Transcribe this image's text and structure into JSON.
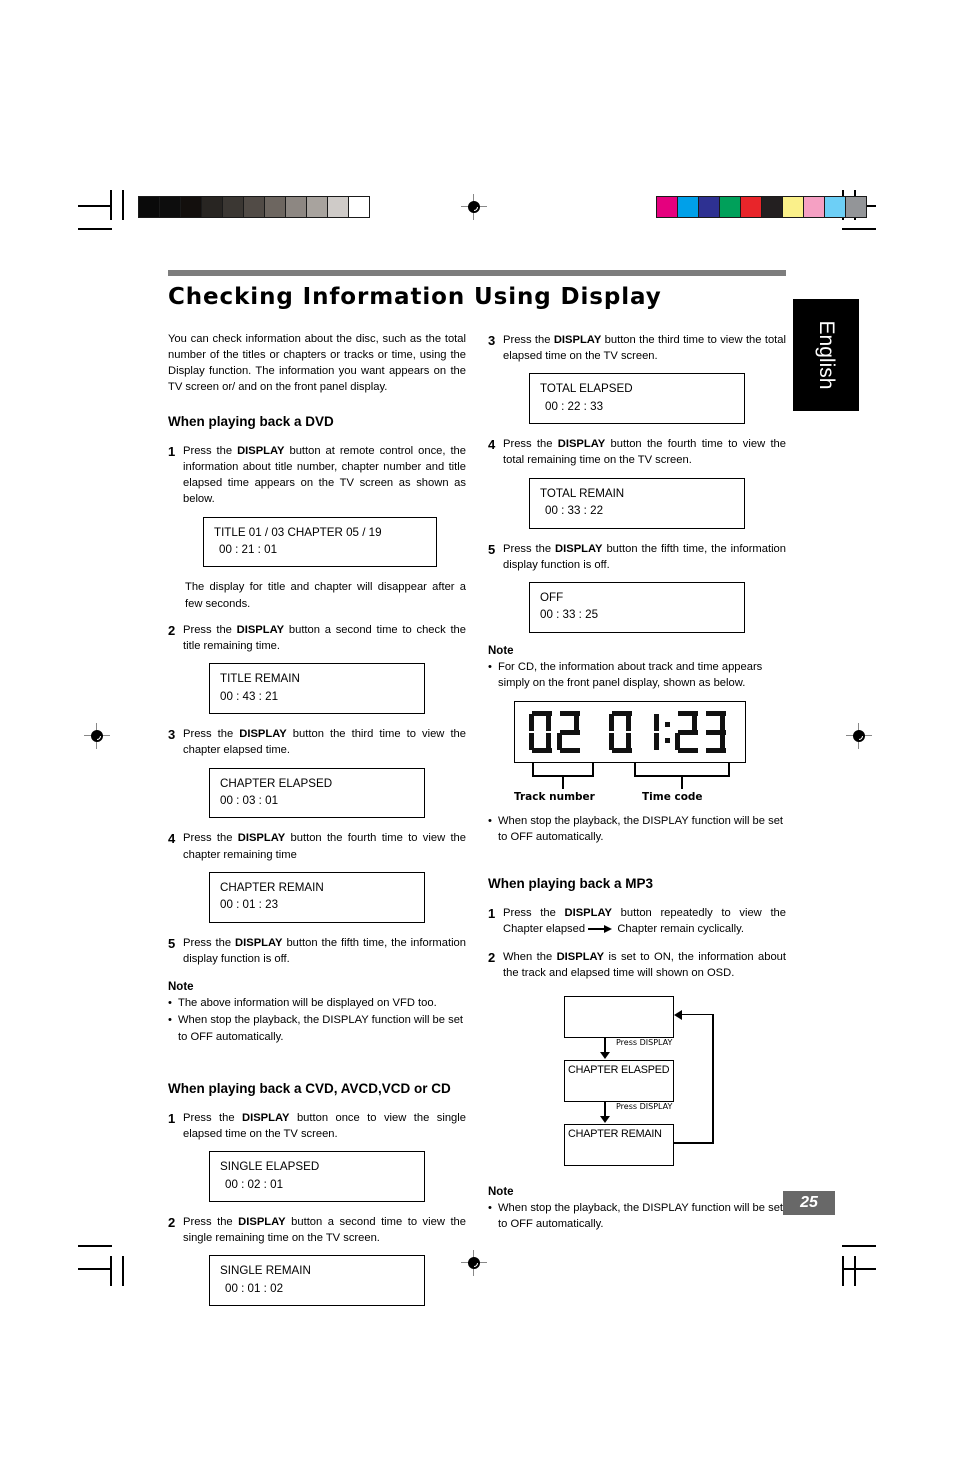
{
  "page": {
    "title": "Checking Information Using Display",
    "language_tab": "English",
    "page_number": "25"
  },
  "intro": "You can check information about the disc, such as the total number of the titles or chapters or tracks or time, using the Display function. The information you want appears on the TV screen or/ and on the front panel display.",
  "sections": {
    "dvd": {
      "heading": "When playing back a DVD",
      "steps": [
        {
          "num": "1",
          "pre": "Press the ",
          "bold": "DISPLAY",
          "post": " button at remote control once, the information about title number, chapter number and title elapsed time appears on the TV screen as shown as below."
        },
        {
          "num": "2",
          "pre": "Press the ",
          "bold": "DISPLAY",
          "post": " button a second time to check the title remaining time."
        },
        {
          "num": "3",
          "pre": "Press the ",
          "bold": "DISPLAY",
          "post": " button the third time to view the chapter elapsed time."
        },
        {
          "num": "4",
          "pre": "Press the ",
          "bold": "DISPLAY",
          "post": " button the fourth time to view the chapter remaining time"
        },
        {
          "num": "5",
          "pre": "Press the ",
          "bold": "DISPLAY",
          "post": " button the fifth time, the information display function is off."
        }
      ],
      "disappear_note": "The display for title and chapter will disappear after a few seconds.",
      "osd": {
        "title_chapter": {
          "line1": "TITLE   01 / 03     CHAPTER   05 / 19",
          "line2": "00 : 21 : 01"
        },
        "title_remain": {
          "line1": "TITLE REMAIN",
          "line2": "00 : 43 : 21"
        },
        "chapter_elapsed": {
          "line1": "CHAPTER ELAPSED",
          "line2": "00 : 03 : 01"
        },
        "chapter_remain": {
          "line1": "CHAPTER REMAIN",
          "line2": "00 : 01 : 23"
        }
      },
      "note": {
        "heading": "Note",
        "items": [
          "The above information will be displayed on VFD too.",
          "When stop the playback, the DISPLAY function will be set to OFF automatically."
        ]
      }
    },
    "cvd": {
      "heading": "When playing back a CVD, AVCD,VCD or CD",
      "steps": [
        {
          "num": "1",
          "pre": "Press the ",
          "bold": "DISPLAY",
          "post": " button once to view the single elapsed time on the TV screen."
        },
        {
          "num": "2",
          "pre": "Press the ",
          "bold": "DISPLAY",
          "post": " button a second time to view the single remaining time on the TV screen."
        },
        {
          "num": "3",
          "pre": "Press the ",
          "bold": "DISPLAY",
          "post": " button the third time to view the total elapsed time on the TV screen."
        },
        {
          "num": "4",
          "pre": "Press the ",
          "bold": "DISPLAY",
          "post": " button the fourth time to view the total remaining time on the TV screen."
        },
        {
          "num": "5",
          "pre": "Press the ",
          "bold": "DISPLAY",
          "post": " button the fifth time, the information display function is off."
        }
      ],
      "osd": {
        "single_elapsed": {
          "line1": "SINGLE ELAPSED",
          "line2": "00 : 02 : 01"
        },
        "single_remain": {
          "line1": "SINGLE REMAIN",
          "line2": "00 : 01 : 02"
        },
        "total_elapsed": {
          "line1": "TOTAL ELAPSED",
          "line2": "00 : 22 : 33"
        },
        "total_remain": {
          "line1": "TOTAL REMAIN",
          "line2": "00 : 33 : 22"
        },
        "off": {
          "line1": "OFF",
          "line2": "00 : 33 : 25"
        }
      },
      "note": {
        "heading": "Note",
        "items": [
          "For CD, the information about track and time appears simply on the front panel display, shown as below.",
          "When stop the playback, the DISPLAY function will be set to OFF automatically."
        ]
      },
      "vfd": {
        "track_digits": "02",
        "time_digits": "0123",
        "time_text": "01:23",
        "label_track": "Track number",
        "label_time": "Time code"
      }
    },
    "mp3": {
      "heading": "When playing back a MP3",
      "steps": [
        {
          "num": "1",
          "pre": "Press the ",
          "bold": "DISPLAY",
          "post_a": " button repeatedly to view the Chapter elapsed ",
          "post_b": " Chapter remain cyclically."
        },
        {
          "num": "2",
          "pre": "When the ",
          "bold": "DISPLAY",
          "post": " is set to ON, the information about the track and elapsed time will shown on OSD."
        }
      ],
      "flow": {
        "box1": "",
        "box2": "CHAPTER ELASPED",
        "box3": "CHAPTER REMAIN",
        "arrow_label_1": "Press DISPLAY",
        "arrow_label_2": "Press DISPLAY"
      },
      "note": {
        "heading": "Note",
        "items": [
          "When stop the playback, the DISPLAY function will be set to OFF automatically."
        ]
      }
    }
  },
  "print_marks": {
    "grayscale_wedge": [
      "#0a0a0a",
      "#0d0d0d",
      "#130f0d",
      "#282522",
      "#3b3733",
      "#514b46",
      "#6d6660",
      "#8d8782",
      "#a8a39e",
      "#cfcbc8",
      "#ffffff"
    ],
    "color_bars": [
      "#e5007e",
      "#00a0e9",
      "#2e3192",
      "#00a05a",
      "#e8252a",
      "#231f20",
      "#faf08a",
      "#f5a0c3",
      "#6dcff6",
      "#939598"
    ]
  }
}
